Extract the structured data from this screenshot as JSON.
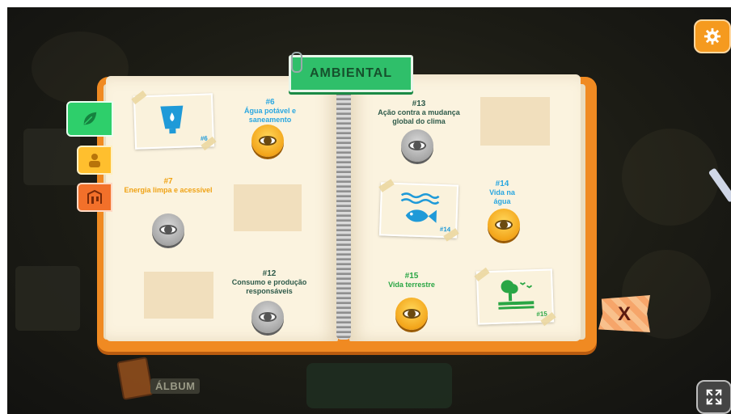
{
  "book": {
    "title": "AMBIENTAL"
  },
  "album": {
    "label": "ÁLBUM"
  },
  "close": {
    "label": "X"
  },
  "goals": {
    "g6": {
      "number": "#6",
      "name": "Água potável e saneamento",
      "card_number": "#6"
    },
    "g7": {
      "number": "#7",
      "name": "Energia limpa e acessível"
    },
    "g12": {
      "number": "#12",
      "name": "Consumo e produção responsáveis"
    },
    "g13": {
      "number": "#13",
      "name": "Ação contra a mudança global do clima"
    },
    "g14": {
      "number": "#14",
      "name": "Vida na água",
      "card_number": "#14"
    },
    "g15": {
      "number": "#15",
      "name": "Vida terrestre",
      "card_number": "#15"
    }
  },
  "icons": {
    "settings": "gear-icon",
    "fullscreen": "expand-icon",
    "tab_environment": "leaf-icon",
    "tab_social": "person-icon",
    "tab_economy": "building-icon",
    "view": "eye-icon"
  },
  "colors": {
    "accent_green": "#2ecf6b",
    "book_orange": "#f08a22",
    "active_eye": "#f3a51a",
    "locked_eye": "#a7a7a7"
  }
}
